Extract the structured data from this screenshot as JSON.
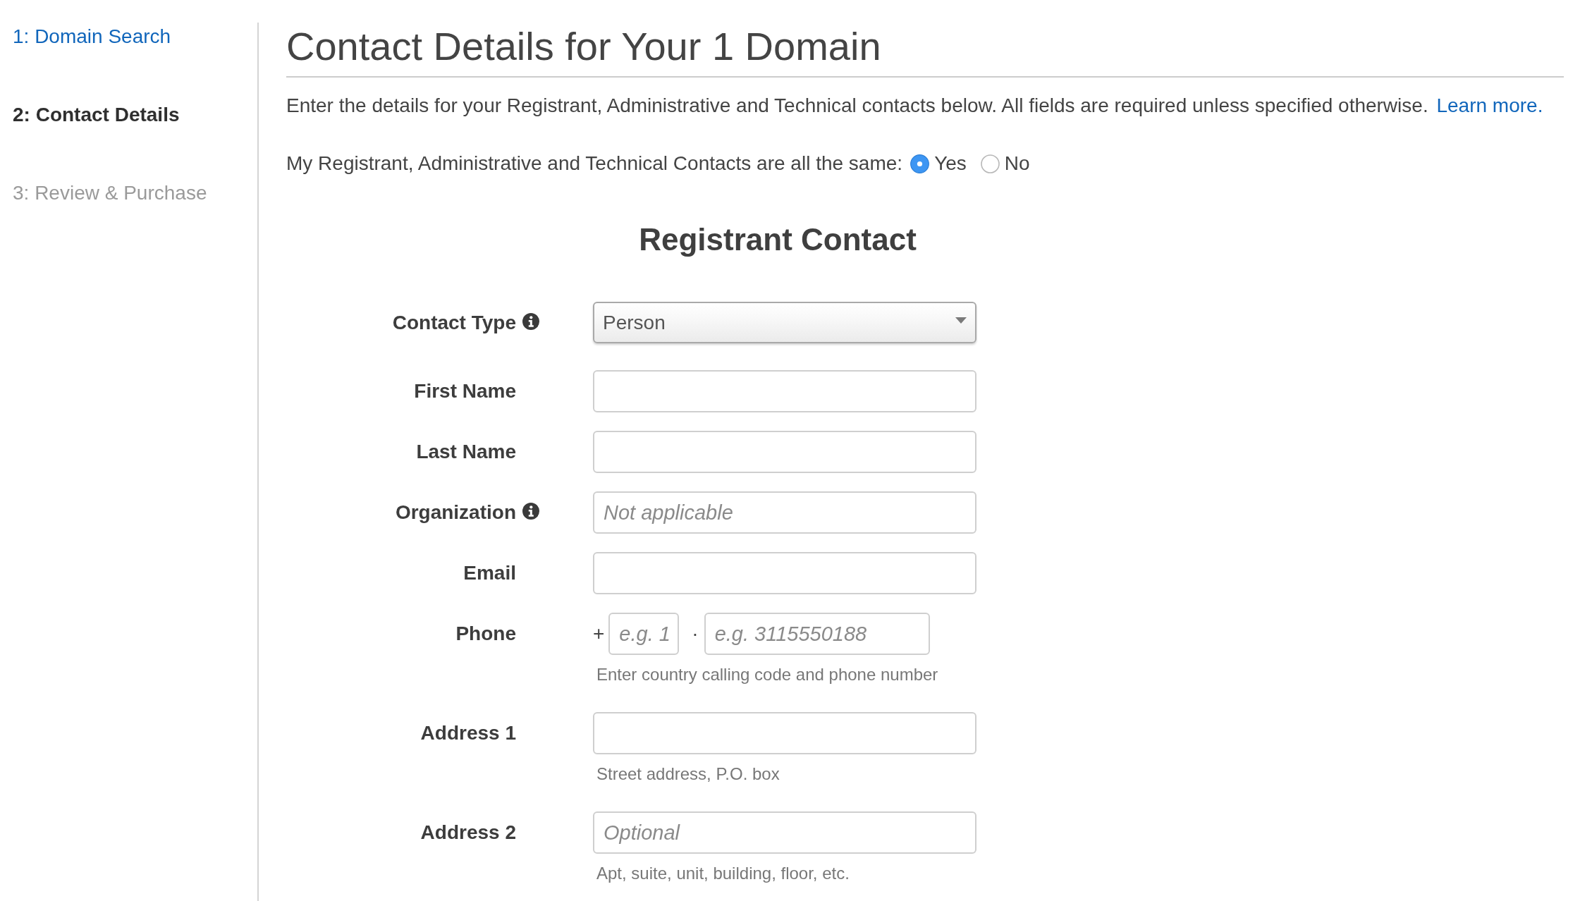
{
  "steps": [
    {
      "label": "1: Domain Search",
      "selected": false,
      "disabled": false
    },
    {
      "label": "2: Contact Details",
      "selected": true,
      "disabled": false
    },
    {
      "label": "3: Review & Purchase",
      "selected": false,
      "disabled": true
    }
  ],
  "title": "Contact Details for Your 1 Domain",
  "intro": {
    "text": "Enter the details for your Registrant, Administrative and Technical contacts below. All fields are required unless specified otherwise.",
    "link": "Learn more."
  },
  "same_contacts": {
    "question": "My Registrant, Administrative and Technical Contacts are all the same:",
    "options": [
      {
        "label": "Yes",
        "selected": true
      },
      {
        "label": "No",
        "selected": false
      }
    ]
  },
  "section_title": "Registrant Contact",
  "fields": [
    {
      "kind": "select",
      "label": "Contact Type",
      "info": true,
      "value": "Person"
    },
    {
      "kind": "text",
      "label": "First Name",
      "info": false
    },
    {
      "kind": "text",
      "label": "Last Name",
      "info": false
    },
    {
      "kind": "text",
      "label": "Organization",
      "info": true,
      "placeholder": "Not applicable"
    },
    {
      "kind": "text",
      "label": "Email",
      "info": false
    },
    {
      "kind": "phone",
      "label": "Phone",
      "info": false,
      "prefix": "+",
      "code_placeholder": "e.g. 1",
      "separator": "·",
      "number_placeholder": "e.g. 3115550188",
      "hint": "Enter country calling code and phone number"
    },
    {
      "kind": "text",
      "label": "Address 1",
      "info": false,
      "hint": "Street address, P.O. box"
    },
    {
      "kind": "text",
      "label": "Address 2",
      "info": false,
      "placeholder": "Optional",
      "hint": "Apt, suite, unit, building, floor, etc."
    }
  ]
}
